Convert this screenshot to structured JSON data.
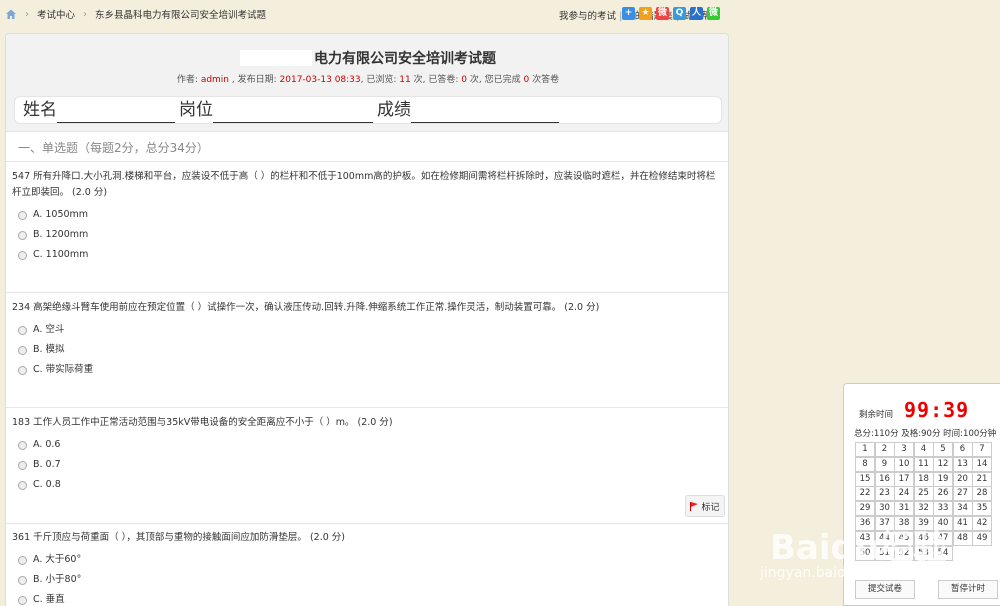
{
  "nav": {
    "crumbs": [
      "考试中心",
      "东乡县晶科电力有限公司安全培训考试题"
    ],
    "links": [
      "我参与的考试",
      "我的错题集",
      "试卷帮助"
    ],
    "share_icons": [
      "add-icon",
      "star-icon",
      "weibo-icon",
      "qq-icon",
      "renren-icon",
      "wechat-icon"
    ]
  },
  "exam": {
    "title": "电力有限公司安全培训考试题",
    "meta_author_label": "作者:",
    "meta_author": "admin",
    "meta_date_label": ", 发布日期:",
    "meta_date": "2017-03-13 08:33",
    "meta_views_label": ", 已浏览:",
    "meta_views": "11",
    "meta_answered_label": "次, 已答卷:",
    "meta_answered": "0",
    "meta_done_label": "次, 您已完成",
    "meta_done": "0",
    "meta_done_suffix": "次答卷",
    "name_label": "姓名",
    "post_label": "岗位",
    "score_label": "成绩",
    "section_title": "一、单选题（每题2分，总分34分）"
  },
  "questions": [
    {
      "text": "547 所有升降口.大小孔洞.楼梯和平台，应装设不低于高（ ）的栏杆和不低于100mm高的护板。如在检修期间需将栏杆拆除时，应装设临时遮栏，并在检修结束时将栏杆立即装回。 (2.0 分)",
      "options": [
        "A. 1050mm",
        "B. 1200mm",
        "C. 1100mm"
      ]
    },
    {
      "text": "234 高架绝缘斗臂车使用前应在预定位置（ ）试操作一次，确认液压传动.回转.升降.伸缩系统工作正常.操作灵活，制动装置可靠。 (2.0 分)",
      "options": [
        "A. 空斗",
        "B. 模拟",
        "C. 带实际荷重"
      ]
    },
    {
      "text": "183 工作人员工作中正常活动范围与35kV带电设备的安全距离应不小于（ ）m。 (2.0 分)",
      "options": [
        "A. 0.6",
        "B. 0.7",
        "C. 0.8"
      ]
    },
    {
      "text": "361 千斤顶应与荷重面（ ），其顶部与重物的接触面间应加防滑垫层。 (2.0 分)",
      "options": [
        "A. 大于60°",
        "B. 小于80°",
        "C. 垂直"
      ]
    }
  ],
  "mark_label": "标记",
  "timer": {
    "label": "剩余时间",
    "value": "99:39",
    "info": "总分:110分 及格:90分 时间:100分钟",
    "numbers": [
      "1",
      "2",
      "3",
      "4",
      "5",
      "6",
      "7",
      "8",
      "9",
      "10",
      "11",
      "12",
      "13",
      "14",
      "15",
      "16",
      "17",
      "18",
      "19",
      "20",
      "21",
      "22",
      "23",
      "24",
      "25",
      "26",
      "27",
      "28",
      "29",
      "30",
      "31",
      "32",
      "33",
      "34",
      "35",
      "36",
      "37",
      "38",
      "39",
      "40",
      "41",
      "42",
      "43",
      "44",
      "45",
      "46",
      "47",
      "48",
      "49",
      "50",
      "51",
      "52",
      "53",
      "54"
    ],
    "submit_label": "提交试卷",
    "pause_label": "暂停计时"
  },
  "watermark": "Baidu经验",
  "watermark_url": "jingyan.baidu.com"
}
